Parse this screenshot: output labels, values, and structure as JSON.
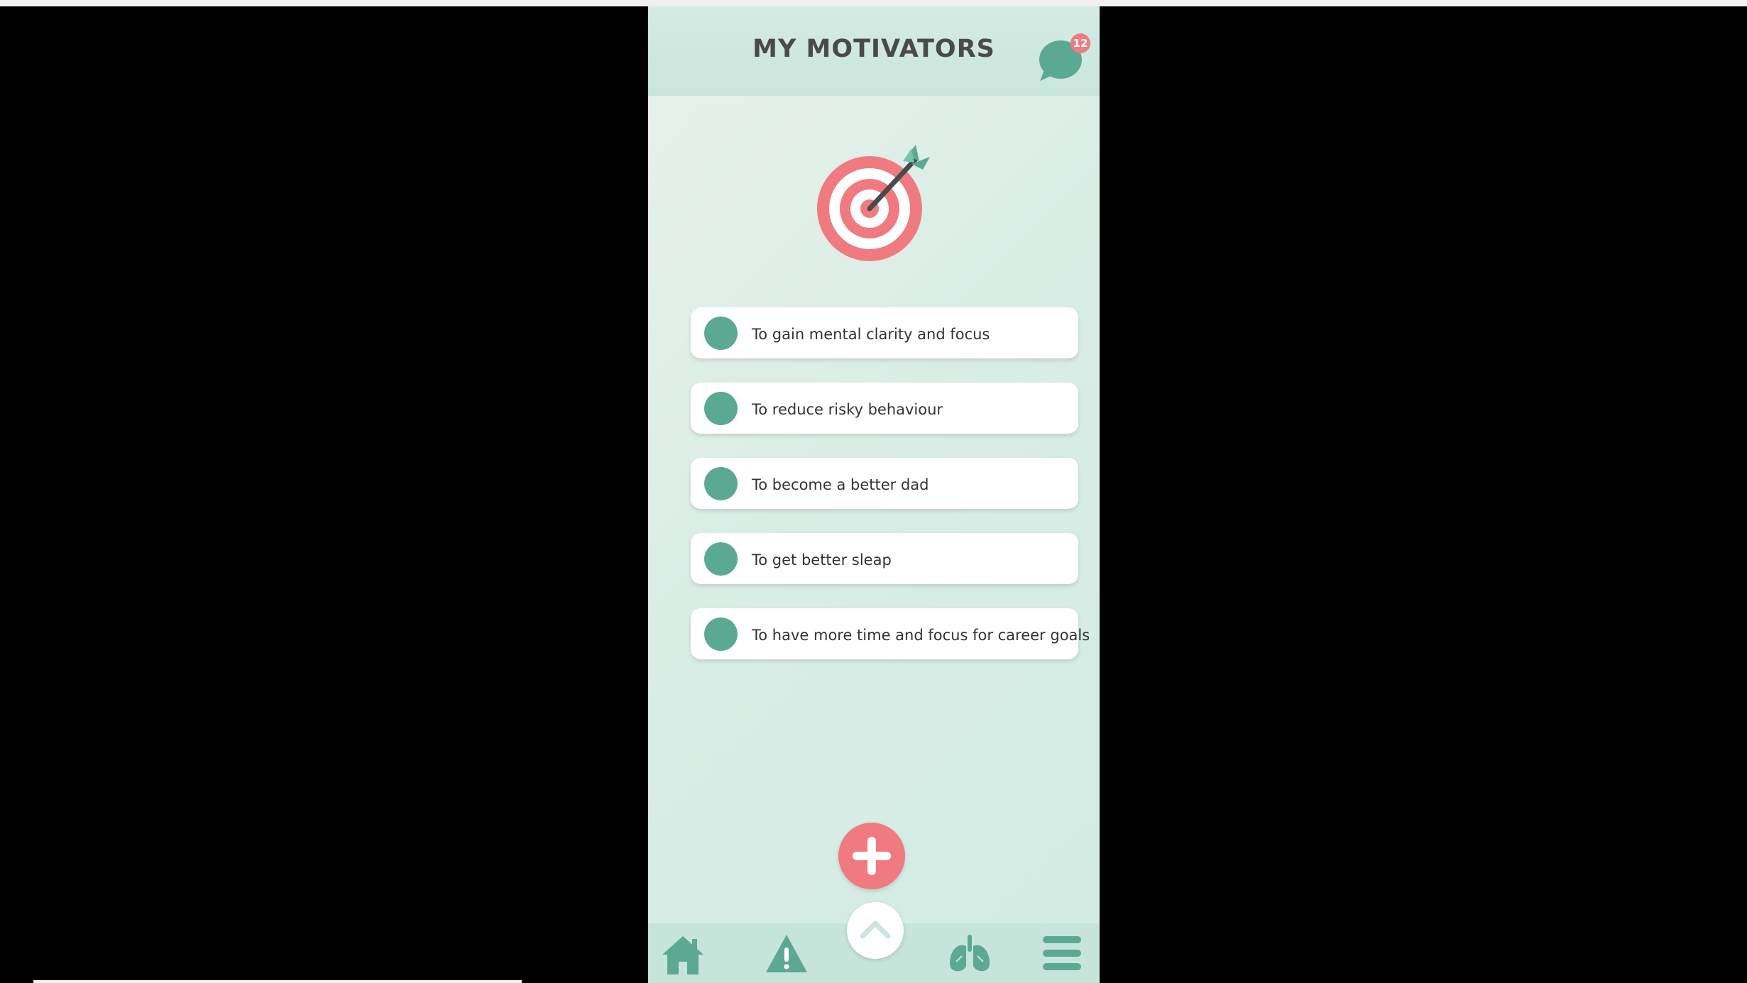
{
  "header": {
    "title": "MY MOTIVATORS",
    "chat_badge_count": "12"
  },
  "icons": {
    "chat": "chat-bubble-icon",
    "hero": "target-arrow-icon",
    "add": "plus-icon",
    "expand": "chevron-up-icon",
    "nav": [
      "home-icon",
      "warning-icon",
      "lungs-icon",
      "menu-icon"
    ]
  },
  "motivators": [
    {
      "label": "To gain mental clarity and focus"
    },
    {
      "label": "To reduce risky behaviour"
    },
    {
      "label": "To become a better dad"
    },
    {
      "label": "To get better sleap"
    },
    {
      "label": "To have more time and focus for career goals"
    }
  ],
  "colors": {
    "accent_green": "#5ba993",
    "accent_pink": "#ef7a80",
    "title_text": "#4a4a4a"
  }
}
